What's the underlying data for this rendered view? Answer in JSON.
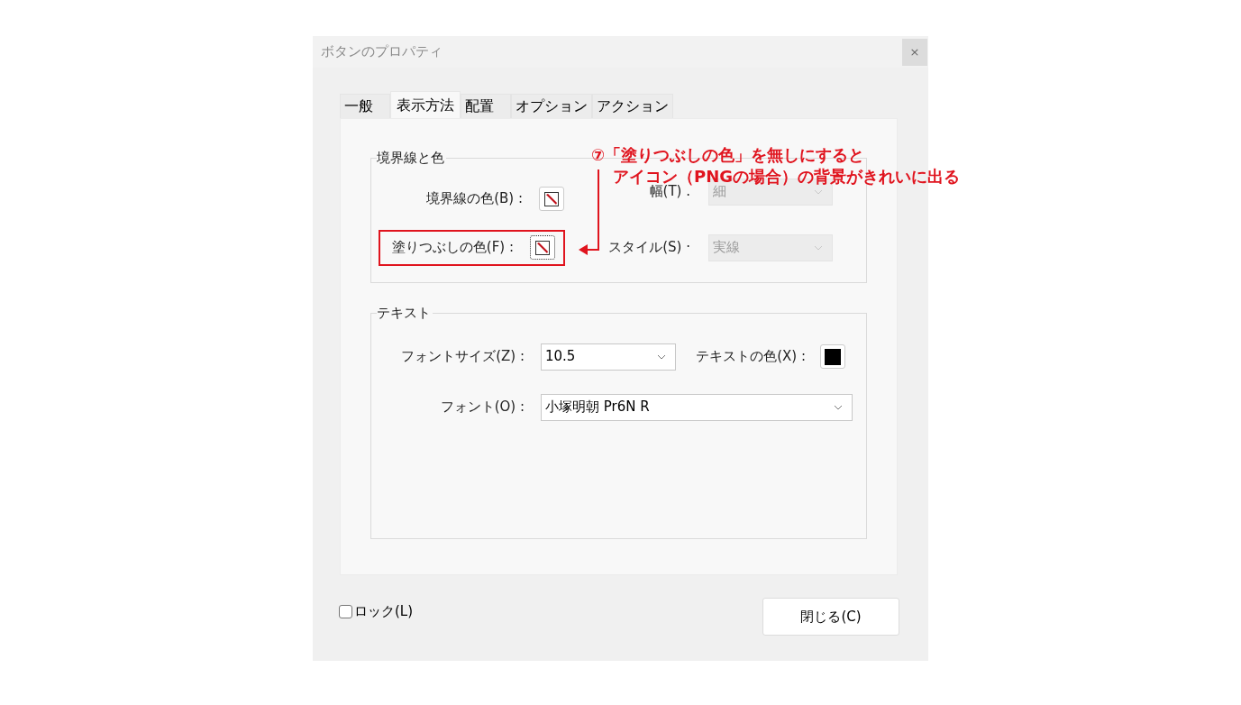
{
  "dialog": {
    "title": "ボタンのプロパティ",
    "close": "×"
  },
  "tabs": [
    {
      "label": "一般",
      "selected": false
    },
    {
      "label": "表示方法",
      "selected": true
    },
    {
      "label": "配置",
      "selected": false
    },
    {
      "label": "オプション",
      "selected": false
    },
    {
      "label": "アクション",
      "selected": false
    }
  ],
  "border_group": {
    "title": "境界線と色",
    "border_color": {
      "label": "境界線の色(B) :",
      "kind": "none"
    },
    "fill_color": {
      "label": "塗りつぶしの色(F) :",
      "kind": "none",
      "focused": true,
      "highlighted": true
    },
    "width": {
      "label": "幅(T) .",
      "value": "細",
      "disabled": true
    },
    "style": {
      "label": "スタイル(S) ·",
      "value": "実線",
      "disabled": true
    }
  },
  "text_group": {
    "title": "テキスト",
    "font_size": {
      "label": "フォントサイズ(Z) :",
      "value": "10.5",
      "disabled": false
    },
    "text_color": {
      "label": "テキストの色(X) :",
      "kind": "solid",
      "color": "#000000"
    },
    "font": {
      "label": "フォント(O) :",
      "value": "小塚明朝 Pr6N R",
      "disabled": false
    }
  },
  "lock": {
    "label": "ロック(L)",
    "checked": false
  },
  "close_button": "閉じる(C)",
  "annotation": {
    "lines": [
      "⑦「塗りつぶしの色」を無しにすると",
      "アイコン（PNGの場合）の背景がきれいに出る"
    ]
  }
}
